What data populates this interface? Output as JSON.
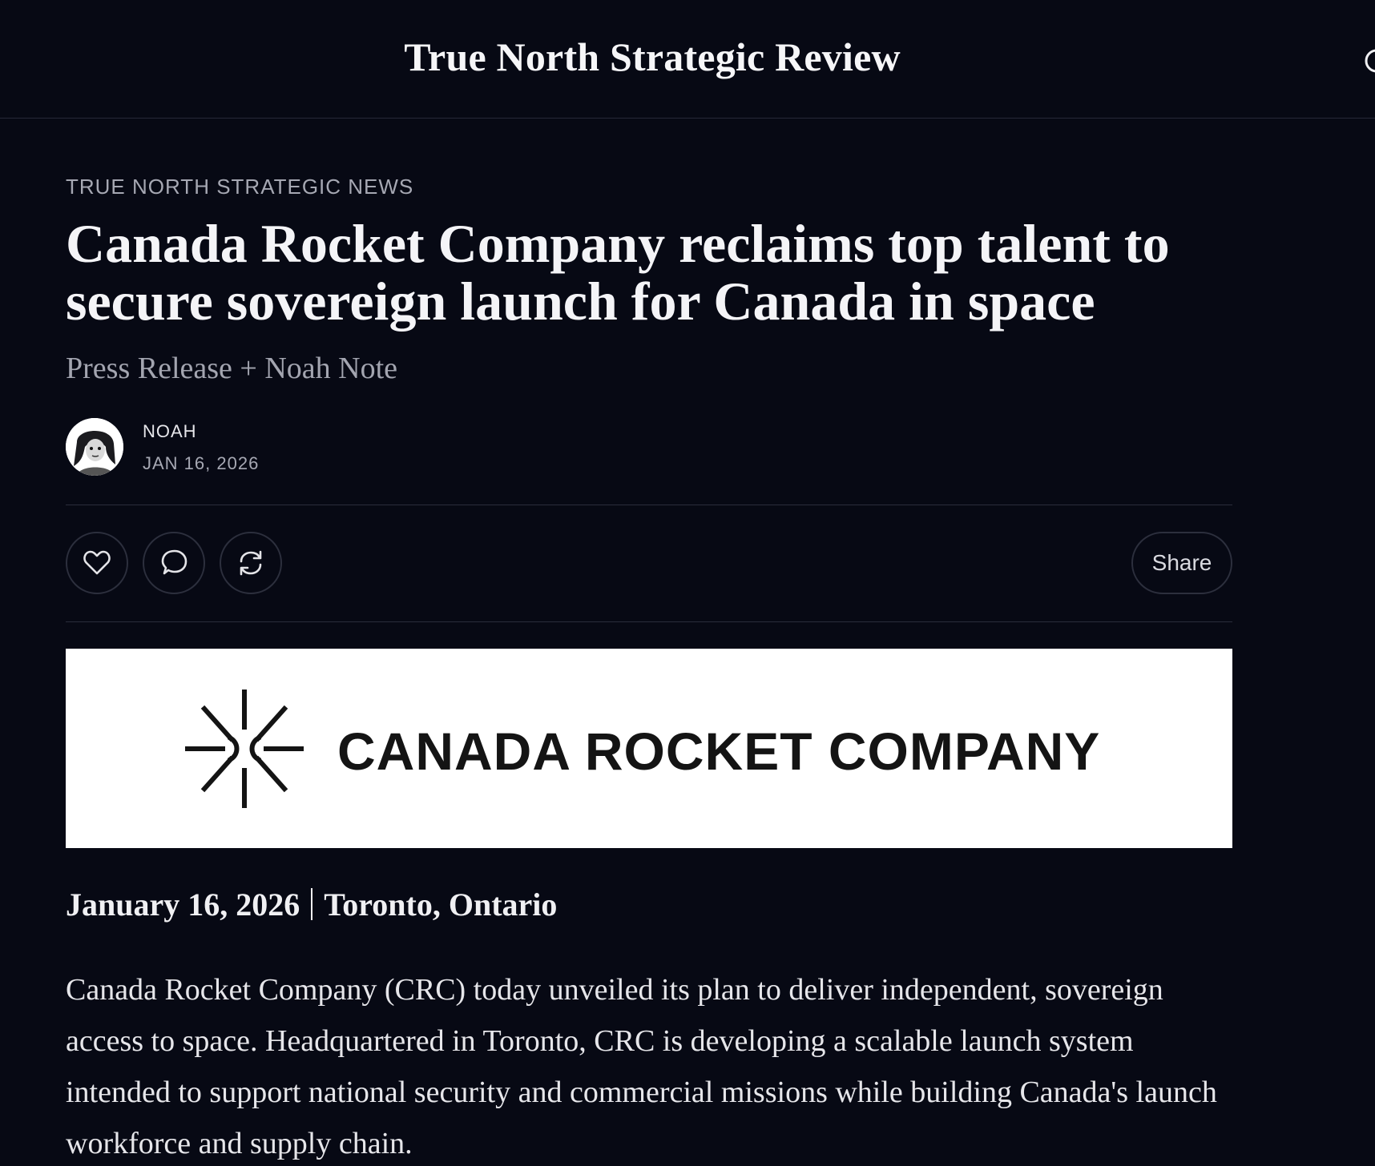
{
  "header": {
    "site_title": "True North Strategic Review",
    "search_icon": "search-icon"
  },
  "article": {
    "section": "TRUE NORTH STRATEGIC NEWS",
    "title": "Canada Rocket Company reclaims top talent to secure sovereign launch for Canada in space",
    "subtitle": "Press Release + Noah Note",
    "author": "NOAH",
    "date": "JAN 16, 2026",
    "actions": {
      "like_icon": "heart-icon",
      "comment_icon": "comment-icon",
      "restack_icon": "restack-icon",
      "share_label": "Share"
    },
    "banner": {
      "logo_icon": "starburst-logo-icon",
      "text": "CANADA ROCKET COMPANY"
    },
    "dateline_date": "January 16, 2026",
    "dateline_place": "Toronto, Ontario",
    "body": "Canada Rocket Company (CRC) today unveiled its plan to deliver independent, sovereign access to space. Headquartered in Toronto, CRC is developing a scalable launch system intended to support national security and commercial missions while building Canada's launch workforce and supply chain."
  },
  "colors": {
    "background": "#070914",
    "text": "#f4f4f7",
    "muted": "#a6a8b3",
    "divider": "#2a2d3b"
  }
}
